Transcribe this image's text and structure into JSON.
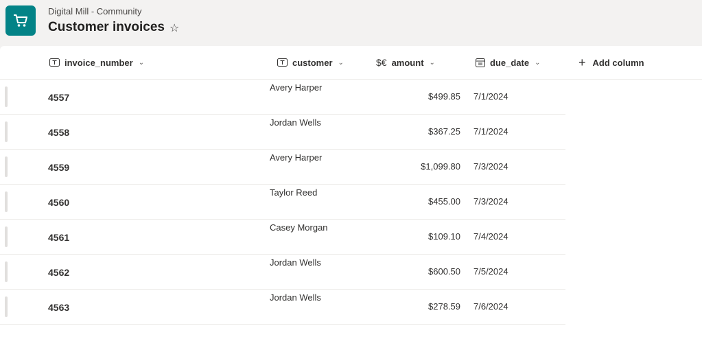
{
  "header": {
    "site_name": "Digital Mill - Community",
    "list_title": "Customer invoices",
    "favorite_glyph": "☆",
    "logo_icon": "shopping-cart-icon",
    "accent_color": "#038387"
  },
  "columns": [
    {
      "label": "invoice_number",
      "icon": "text-column-icon"
    },
    {
      "label": "customer",
      "icon": "text-column-icon"
    },
    {
      "label": "amount",
      "icon": "currency-column-icon"
    },
    {
      "label": "due_date",
      "icon": "calendar-column-icon"
    }
  ],
  "add_column": {
    "label": "Add column",
    "glyph": "+"
  },
  "chevron_glyph": "⌄",
  "currency_glyph": "$€",
  "rows": [
    {
      "invoice_number": "4557",
      "customer": "Avery Harper",
      "amount": "$499.85",
      "due_date": "7/1/2024"
    },
    {
      "invoice_number": "4558",
      "customer": "Jordan Wells",
      "amount": "$367.25",
      "due_date": "7/1/2024"
    },
    {
      "invoice_number": "4559",
      "customer": "Avery Harper",
      "amount": "$1,099.80",
      "due_date": "7/3/2024"
    },
    {
      "invoice_number": "4560",
      "customer": "Taylor Reed",
      "amount": "$455.00",
      "due_date": "7/3/2024"
    },
    {
      "invoice_number": "4561",
      "customer": "Casey Morgan",
      "amount": "$109.10",
      "due_date": "7/4/2024"
    },
    {
      "invoice_number": "4562",
      "customer": "Jordan Wells",
      "amount": "$600.50",
      "due_date": "7/5/2024"
    },
    {
      "invoice_number": "4563",
      "customer": "Jordan Wells",
      "amount": "$278.59",
      "due_date": "7/6/2024"
    }
  ]
}
